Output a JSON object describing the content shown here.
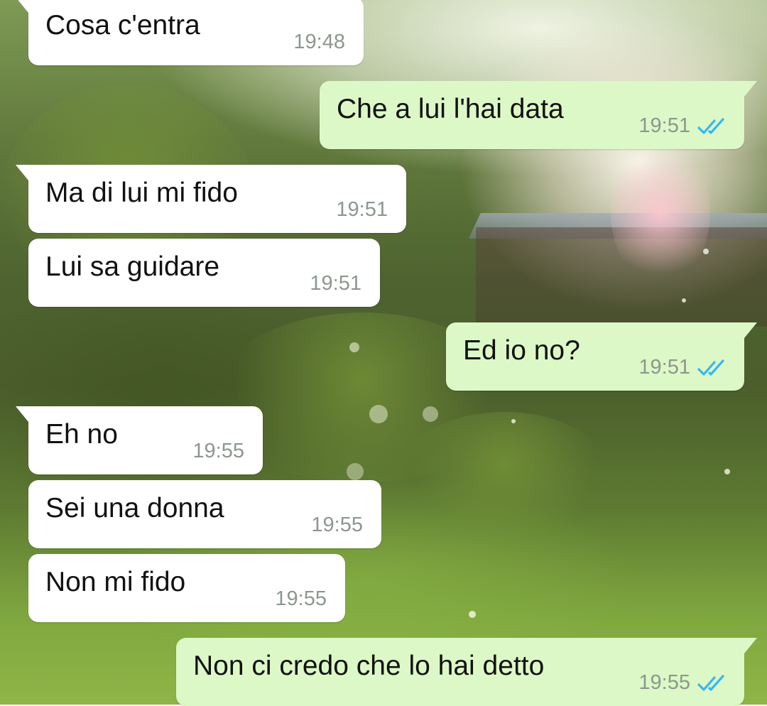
{
  "colors": {
    "incoming_bubble": "#ffffff",
    "outgoing_bubble": "#dcf8c6",
    "timestamp": "#8d978f",
    "read_ticks": "#34b7f1"
  },
  "messages": [
    {
      "direction": "incoming",
      "text": "Cosa c'entra",
      "time": "19:48"
    },
    {
      "direction": "outgoing",
      "text": "Che a lui l'hai data",
      "time": "19:51",
      "status_icon": "double-check-read-icon"
    },
    {
      "direction": "incoming",
      "text": "Ma di lui mi fido",
      "time": "19:51"
    },
    {
      "direction": "incoming",
      "text": "Lui sa guidare",
      "time": "19:51"
    },
    {
      "direction": "outgoing",
      "text": "Ed io no?",
      "time": "19:51",
      "status_icon": "double-check-read-icon"
    },
    {
      "direction": "incoming",
      "text": "Eh no",
      "time": "19:55"
    },
    {
      "direction": "incoming",
      "text": "Sei una donna",
      "time": "19:55"
    },
    {
      "direction": "incoming",
      "text": "Non mi fido",
      "time": "19:55"
    },
    {
      "direction": "outgoing",
      "text": "Non ci credo che lo hai detto",
      "time": "19:55",
      "status_icon": "double-check-read-icon"
    }
  ]
}
